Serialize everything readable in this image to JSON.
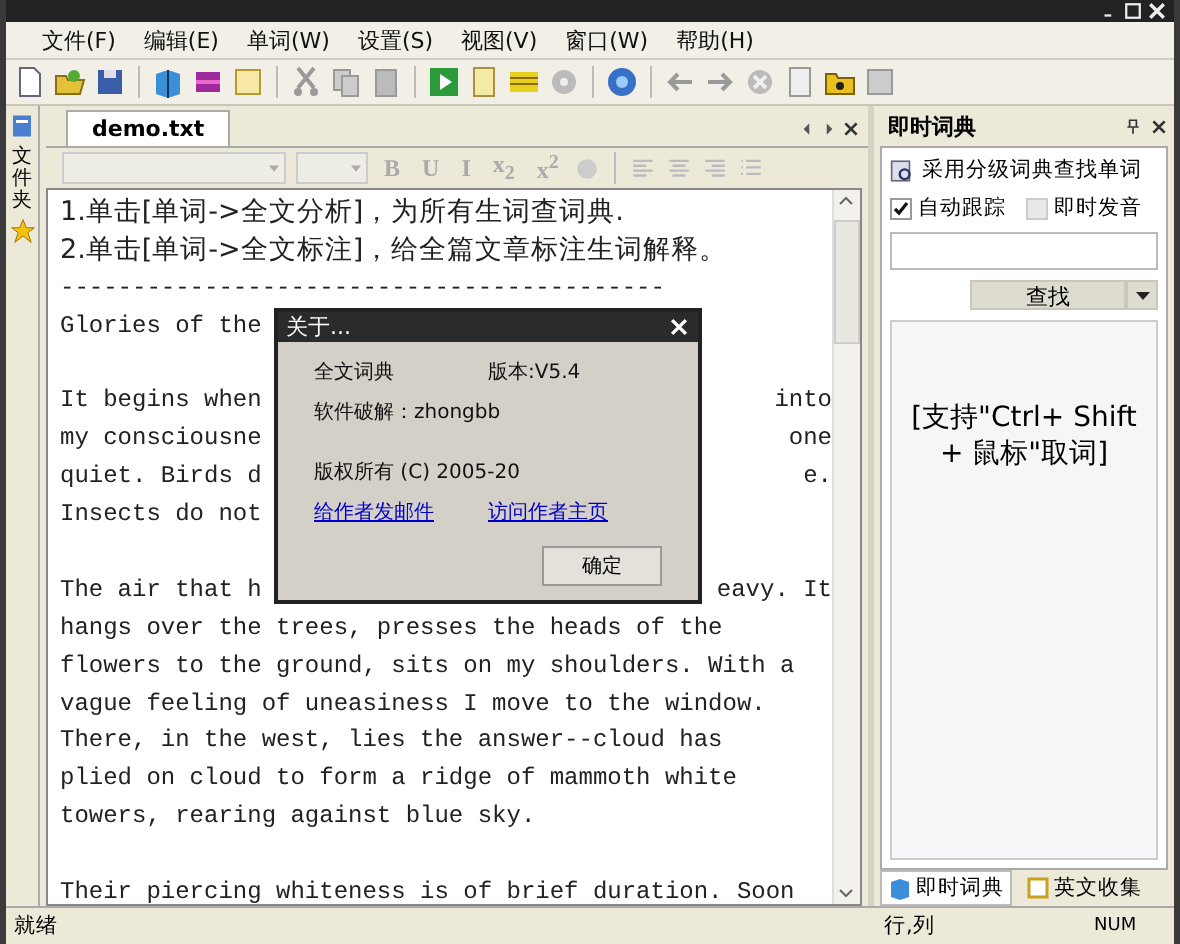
{
  "menu": [
    {
      "label": "文件(F)"
    },
    {
      "label": "编辑(E)"
    },
    {
      "label": "单词(W)"
    },
    {
      "label": "设置(S)"
    },
    {
      "label": "视图(V)"
    },
    {
      "label": "窗口(W)"
    },
    {
      "label": "帮助(H)"
    }
  ],
  "sidebar": {
    "label": "文件夹"
  },
  "document_tab": {
    "label": "demo.txt",
    "selected": true
  },
  "format_bar": {
    "buttons": [
      "B",
      "U",
      "I",
      "x$_{2}$",
      "x$^{2}$"
    ]
  },
  "editor": {
    "lines": [
      {
        "kind": "cjk",
        "text": "1.单击[单词->全文分析]，为所有生词查词典."
      },
      {
        "kind": "cjk",
        "text": "2.单击[单词->全文标注]，给全篇文章标注生词解释。"
      },
      {
        "kind": "text",
        "text": "------------------------------------------"
      },
      {
        "kind": "text",
        "text": "Glories of the"
      },
      {
        "kind": "blank"
      },
      {
        "kind": "split",
        "text": "It begins when",
        "tail": "into"
      },
      {
        "kind": "split",
        "text": "my consciousne",
        "tail": "one"
      },
      {
        "kind": "split",
        "text": "quiet. Birds d",
        "tail": "e."
      },
      {
        "kind": "text",
        "text": "Insects do not"
      },
      {
        "kind": "blank"
      },
      {
        "kind": "split",
        "text": "The air that h",
        "tail": "eavy. It"
      },
      {
        "kind": "text",
        "text": "hangs over the trees, presses the heads of the"
      },
      {
        "kind": "text",
        "text": "flowers to the ground, sits on my shoulders. With a"
      },
      {
        "kind": "text",
        "text": "vague feeling of uneasiness I move to the window."
      },
      {
        "kind": "text",
        "text": "There, in the west, lies the answer--cloud has"
      },
      {
        "kind": "text",
        "text": "plied on cloud to form a ridge of mammoth white"
      },
      {
        "kind": "text",
        "text": "towers, rearing against blue sky."
      },
      {
        "kind": "blank"
      },
      {
        "kind": "text",
        "text": "Their piercing whiteness is of brief duration. Soon"
      }
    ]
  },
  "dict_panel": {
    "title": "即时词典",
    "hint": "采用分级词典查找单词",
    "options": [
      {
        "label": "自动跟踪",
        "checked": true
      },
      {
        "label": "即时发音",
        "checked": false
      }
    ],
    "search_button": "查找",
    "result": "[支持\"Ctrl+ Shift + 鼠标\"取词]",
    "tabs": [
      {
        "label": "即时词典",
        "selected": true
      },
      {
        "label": "英文收集",
        "selected": false
      }
    ]
  },
  "dialog": {
    "title": "关于...",
    "app_name": "全文词典",
    "version": "版本:V5.4",
    "crack": "软件破解：zhongbb",
    "copyright": "版权所有 (C) 2005-20",
    "links": [
      "给作者发邮件",
      "访问作者主页"
    ],
    "ok": "确定"
  },
  "status_bar": {
    "message": "就绪",
    "position": "行,列",
    "num": "NUM"
  }
}
